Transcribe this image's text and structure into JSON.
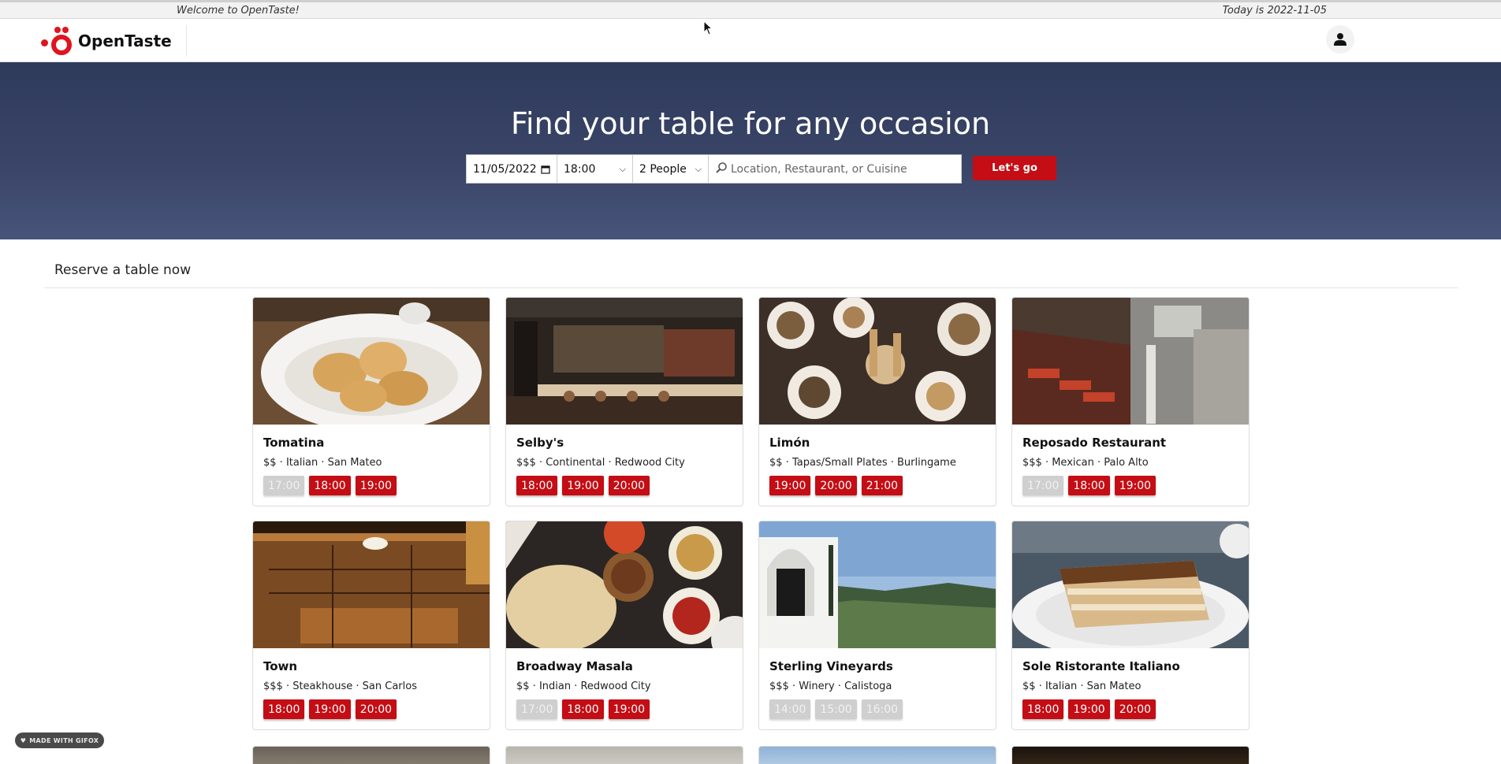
{
  "topbar": {
    "welcome": "Welcome to OpenTaste!",
    "today": "Today is 2022-11-05"
  },
  "header": {
    "logo_text": "OpenTaste",
    "profile_icon": "user-icon"
  },
  "hero": {
    "title": "Find your table for any occasion",
    "date_value": "11/05/2022",
    "time_value": "18:00",
    "people_value": "2 People",
    "search_placeholder": "Location, Restaurant, or Cuisine",
    "go_label": "Let's go"
  },
  "section": {
    "title": "Reserve a table now"
  },
  "restaurants": [
    {
      "name": "Tomatina",
      "meta": "$$ · Italian · San Mateo",
      "slots": [
        {
          "t": "17:00",
          "on": false
        },
        {
          "t": "18:00",
          "on": true
        },
        {
          "t": "19:00",
          "on": true
        }
      ],
      "image": "bread-bites"
    },
    {
      "name": "Selby's",
      "meta": "$$$ · Continental · Redwood City",
      "slots": [
        {
          "t": "18:00",
          "on": true
        },
        {
          "t": "19:00",
          "on": true
        },
        {
          "t": "20:00",
          "on": true
        }
      ],
      "image": "dining-room"
    },
    {
      "name": "Limón",
      "meta": "$$ · Tapas/Small Plates · Burlingame",
      "slots": [
        {
          "t": "19:00",
          "on": true
        },
        {
          "t": "20:00",
          "on": true
        },
        {
          "t": "21:00",
          "on": true
        }
      ],
      "image": "small-plates"
    },
    {
      "name": "Reposado Restaurant",
      "meta": "$$$ · Mexican · Palo Alto",
      "slots": [
        {
          "t": "17:00",
          "on": false
        },
        {
          "t": "18:00",
          "on": true
        },
        {
          "t": "19:00",
          "on": true
        }
      ],
      "image": "long-room"
    },
    {
      "name": "Town",
      "meta": "$$$ · Steakhouse · San Carlos",
      "slots": [
        {
          "t": "18:00",
          "on": true
        },
        {
          "t": "19:00",
          "on": true
        },
        {
          "t": "20:00",
          "on": true
        }
      ],
      "image": "building-sign"
    },
    {
      "name": "Broadway Masala",
      "meta": "$$ · Indian · Redwood City",
      "slots": [
        {
          "t": "17:00",
          "on": false
        },
        {
          "t": "18:00",
          "on": true
        },
        {
          "t": "19:00",
          "on": true
        }
      ],
      "image": "indian-spread"
    },
    {
      "name": "Sterling Vineyards",
      "meta": "$$$ · Winery · Calistoga",
      "slots": [
        {
          "t": "14:00",
          "on": false
        },
        {
          "t": "15:00",
          "on": false
        },
        {
          "t": "16:00",
          "on": false
        }
      ],
      "image": "vineyard-view"
    },
    {
      "name": "Sole Ristorante Italiano",
      "meta": "$$ · Italian · San Mateo",
      "slots": [
        {
          "t": "18:00",
          "on": true
        },
        {
          "t": "19:00",
          "on": true
        },
        {
          "t": "20:00",
          "on": true
        }
      ],
      "image": "tiramisu"
    }
  ],
  "badge": {
    "text": "MADE WITH GIFOX"
  }
}
